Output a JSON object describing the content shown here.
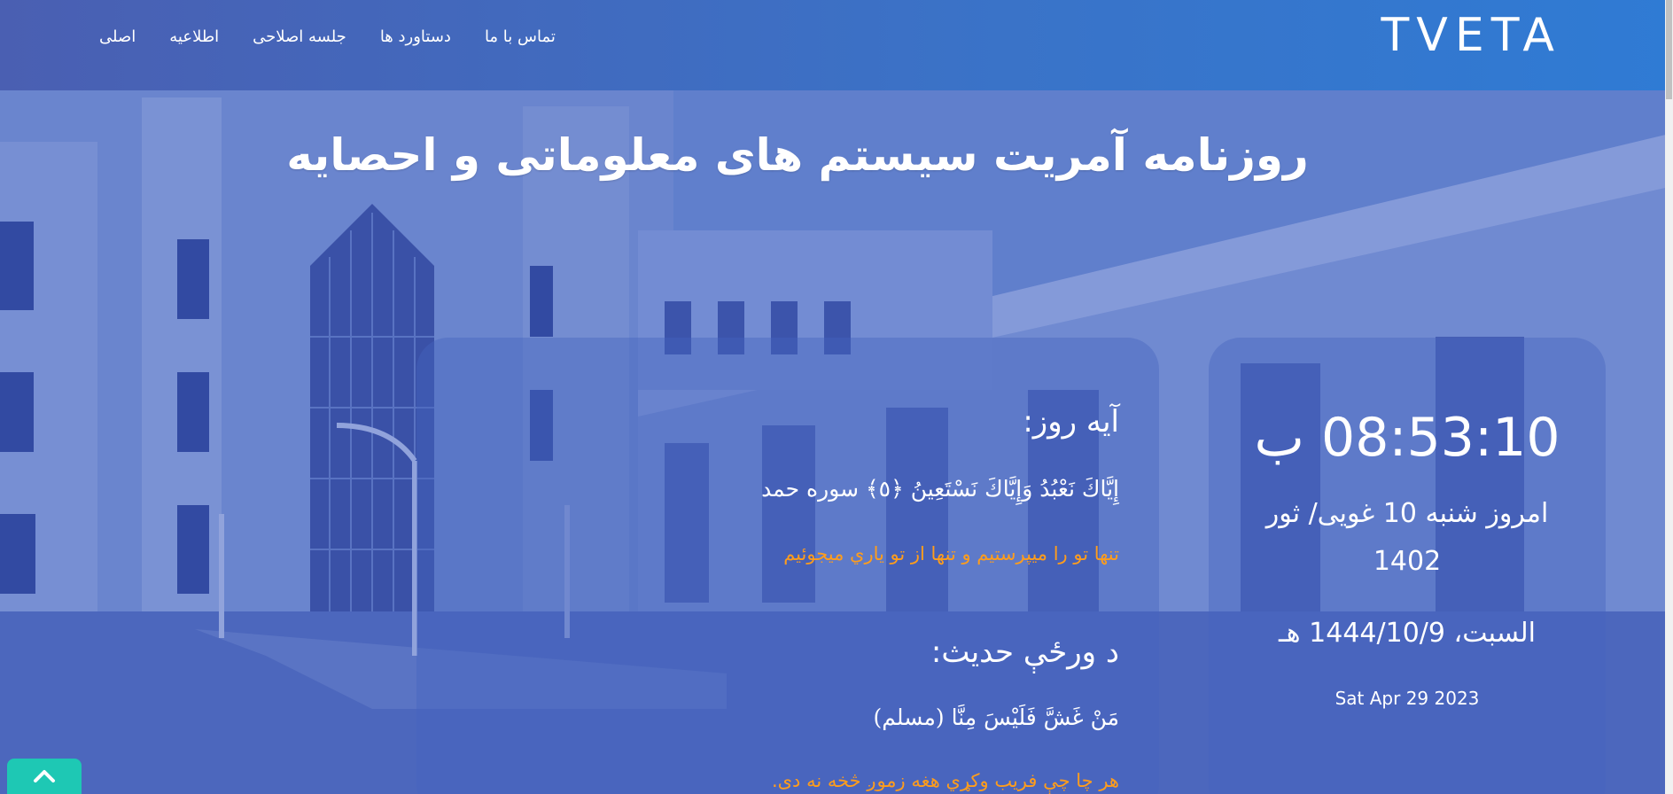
{
  "navbar": {
    "brand": "TVETA",
    "items": [
      {
        "label": "اصلی"
      },
      {
        "label": "اطلاعیه"
      },
      {
        "label": "جلسه اصلاحی"
      },
      {
        "label": "دستاورد ها"
      },
      {
        "label": "تماس با ما"
      }
    ]
  },
  "headline": "روزنامه آمریت سیستم های معلوماتی و احصایه",
  "verse_section": {
    "title": "آیه روز:",
    "arabic": "إِيَّاكَ نَعْبُدُ وَإِيَّاكَ نَسْتَعِينُ ﴿٥﴾ سوره حمد",
    "translation": "تنها تو را میپرستیم و تنها از تو ياري ميجوئيم"
  },
  "hadith_section": {
    "title": "د ورځې حديث:",
    "arabic": "مَنْ غَشَّ فَلَيْسَ مِنَّا (مسلم)",
    "translation": "هر چا چې فريب وکړي هغه زموږ څخه نه دی."
  },
  "clock": {
    "time": "08:53:10 ب",
    "shamsi_date": "امروز شنبه 10 غویی/ ثور 1402",
    "hijri_date": "السبت، 1444/10/9 هـ",
    "gregorian_date": "Sat Apr 29 2023"
  },
  "colors": {
    "accent_orange": "#ff9d1c",
    "back_to_top": "#1ec8b4",
    "navbar": "#3a73c8"
  },
  "icons": {
    "back_to_top": "chevron-up-icon"
  }
}
